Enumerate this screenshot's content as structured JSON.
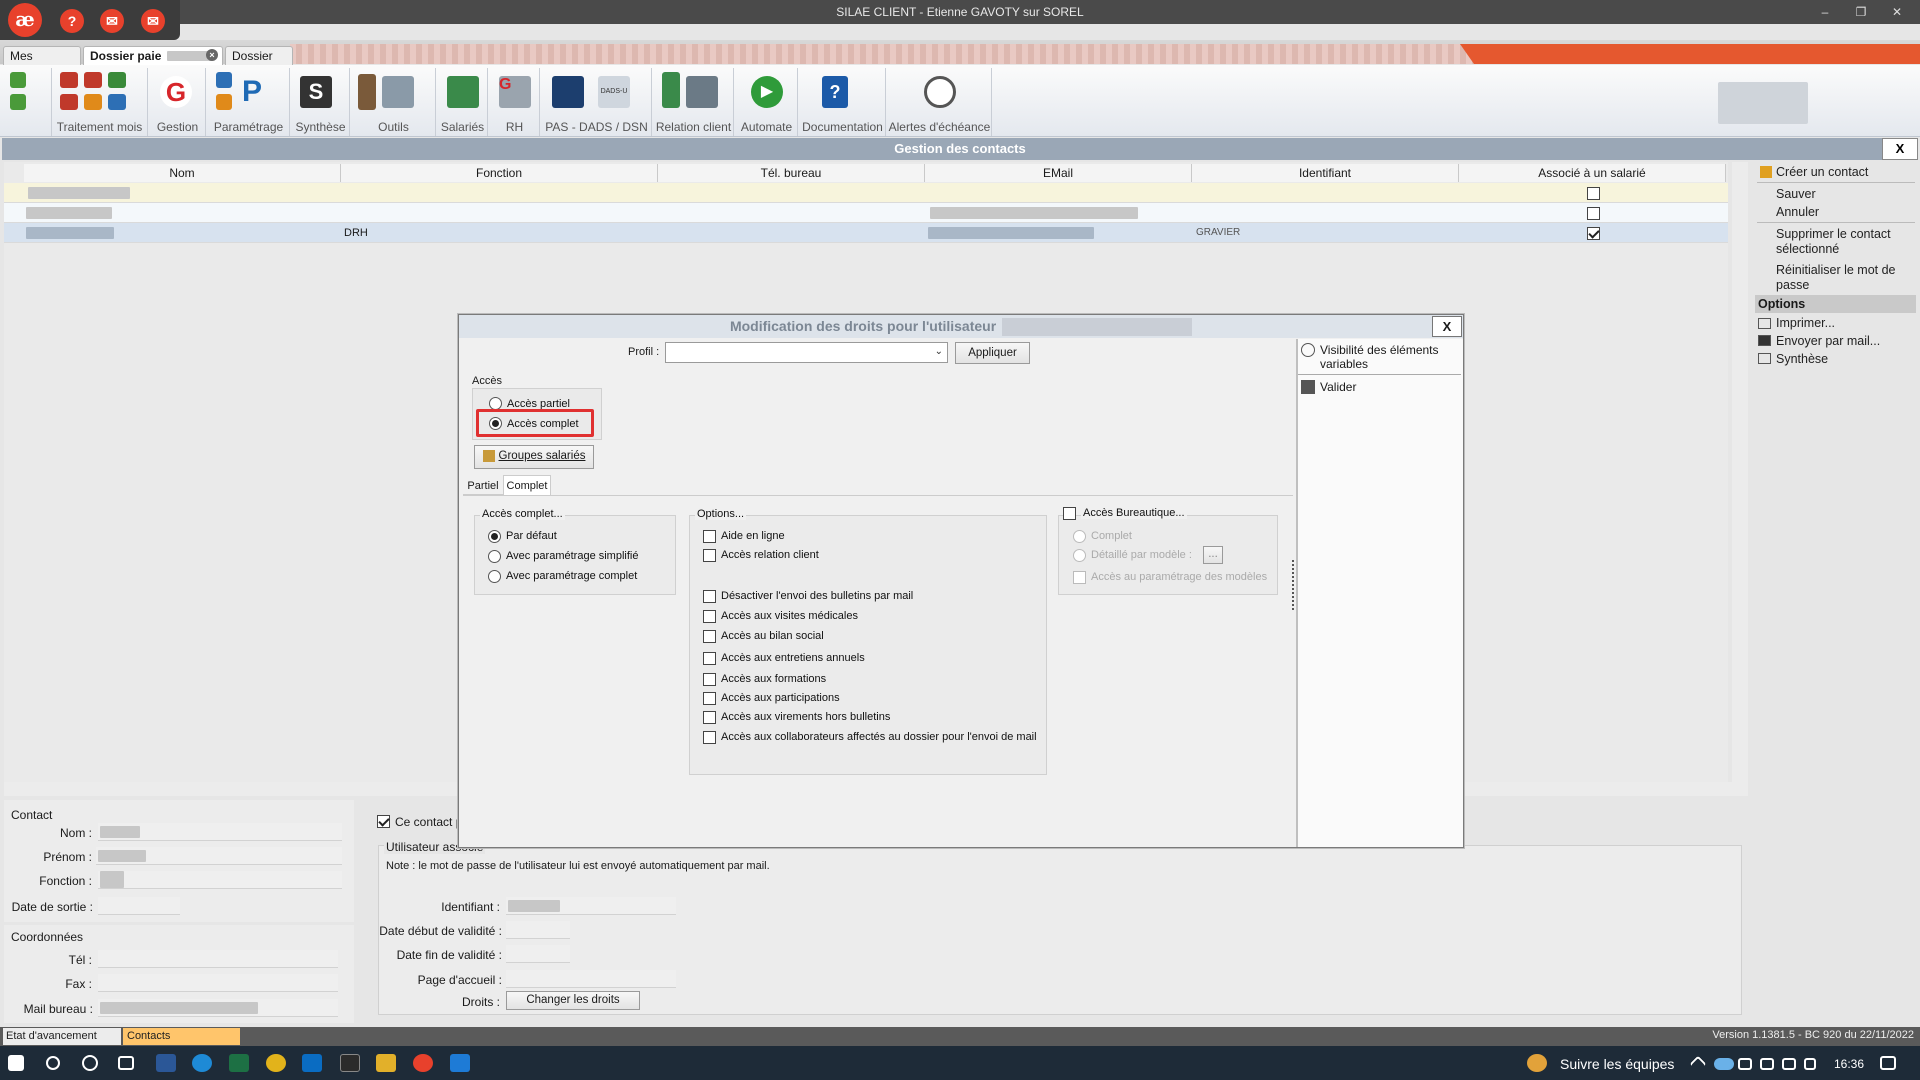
{
  "window": {
    "title": "SILAE CLIENT - Etienne GAVOTY sur SOREL",
    "min": "–",
    "max": "❐",
    "close": "✕"
  },
  "app_icons": {
    "logo": "æ",
    "help": "?",
    "chat": "✉",
    "notif": "✉",
    "notif_count": "1"
  },
  "tabs": [
    {
      "label": "Mes dossiers"
    },
    {
      "label": "Dossier paie"
    },
    {
      "label": "Dossier paie"
    }
  ],
  "ribbon": {
    "groups": [
      "Traitement mois",
      "Gestion",
      "Paramétrage",
      "Synthèse",
      "Outils",
      "Salariés",
      "RH",
      "PAS - DADS / DSN",
      "Relation client",
      "Automate",
      "Documentation",
      "Alertes d'échéance"
    ]
  },
  "contacts": {
    "title": "Gestion des contacts",
    "close": "X",
    "columns": [
      "Nom",
      "Fonction",
      "Tél. bureau",
      "EMail",
      "Identifiant",
      "Associé à un salarié"
    ],
    "rows": [
      {
        "fonction": "",
        "identifiant": "",
        "associe": false
      },
      {
        "fonction": "",
        "identifiant": "",
        "associe": false
      },
      {
        "fonction": "DRH",
        "identifiant": "GRAVIER",
        "associe": true
      }
    ]
  },
  "actions": {
    "create": "Créer un contact",
    "save": "Sauver",
    "cancel": "Annuler",
    "delete": "Supprimer le contact sélectionné",
    "reset_pwd": "Réinitialiser le mot de passe",
    "options_head": "Options",
    "print": "Imprimer...",
    "mail": "Envoyer par mail...",
    "synthese": "Synthèse"
  },
  "contact_form": {
    "section_contact": "Contact",
    "nom": "Nom :",
    "prenom": "Prénom :",
    "fonction": "Fonction :",
    "date_sortie": "Date de sortie :",
    "section_coord": "Coordonnées",
    "tel": "Tél :",
    "fax": "Fax :",
    "mail": "Mail bureau :",
    "ce_contact": "Ce contact p",
    "section_user": "Utilisateur associé",
    "note": "Note : le mot de passe de l'utilisateur lui est envoyé automatiquement par mail.",
    "identifiant": "Identifiant :",
    "date_debut": "Date début de validité :",
    "date_fin": "Date fin de validité :",
    "page_accueil": "Page d'accueil :",
    "droits": "Droits :",
    "changer_droits": "Changer les droits"
  },
  "modal": {
    "title": "Modification des droits pour l'utilisateur",
    "close": "X",
    "profil_label": "Profil :",
    "profil_value": "",
    "apply": "Appliquer",
    "acces_label": "Accès",
    "acces_partiel": "Accès partiel",
    "acces_complet": "Accès complet",
    "groupes": "Groupes salariés",
    "subtabs": [
      "Partiel",
      "Complet"
    ],
    "complet_group": "Accès complet...",
    "complet_opts": [
      "Par défaut",
      "Avec paramétrage simplifié",
      "Avec paramétrage complet"
    ],
    "options_group": "Options...",
    "options": [
      "Aide en ligne",
      "Accès relation client",
      "Désactiver l'envoi des bulletins par mail",
      "Accès aux visites médicales",
      "Accès au bilan social",
      "Accès aux entretiens annuels",
      "Accès aux formations",
      "Accès aux participations",
      "Accès aux virements hors bulletins",
      "Accès aux collaborateurs affectés au dossier pour l'envoi de mail"
    ],
    "bureau_group": "Accès Bureautique...",
    "bureau_opts": [
      "Complet",
      "Détaillé par modèle :",
      "Accès au paramétrage des modèles"
    ],
    "ellipsis": "...",
    "side_visibility": "Visibilité des éléments variables",
    "side_validate": "Valider"
  },
  "status": {
    "left_tab": "Etat d'avancement",
    "active_tab": "Contacts",
    "version": "Version 1.1381.5 - BC 920 du 22/11/2022"
  },
  "taskbar": {
    "teams": "Suivre les équipes",
    "time": "16:36"
  },
  "colors": {
    "accent": "#e8412c",
    "highlight": "#e03030",
    "selection": "#d7e2ef"
  }
}
